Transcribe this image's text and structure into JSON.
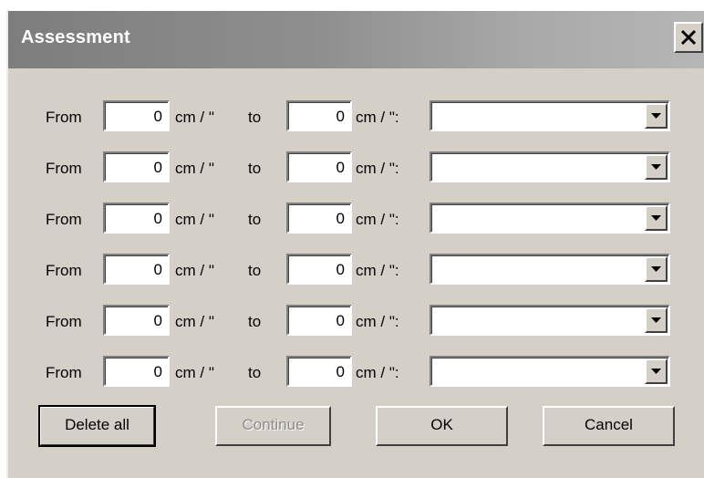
{
  "window": {
    "title": "Assessment"
  },
  "rows": [
    {
      "from_label": "From",
      "from_value": "0",
      "unit1": "cm / \"",
      "to_label": "to",
      "to_value": "0",
      "unit2": "cm / \":",
      "selected": ""
    },
    {
      "from_label": "From",
      "from_value": "0",
      "unit1": "cm / \"",
      "to_label": "to",
      "to_value": "0",
      "unit2": "cm / \":",
      "selected": ""
    },
    {
      "from_label": "From",
      "from_value": "0",
      "unit1": "cm / \"",
      "to_label": "to",
      "to_value": "0",
      "unit2": "cm / \":",
      "selected": ""
    },
    {
      "from_label": "From",
      "from_value": "0",
      "unit1": "cm / \"",
      "to_label": "to",
      "to_value": "0",
      "unit2": "cm / \":",
      "selected": ""
    },
    {
      "from_label": "From",
      "from_value": "0",
      "unit1": "cm / \"",
      "to_label": "to",
      "to_value": "0",
      "unit2": "cm / \":",
      "selected": ""
    },
    {
      "from_label": "From",
      "from_value": "0",
      "unit1": "cm / \"",
      "to_label": "to",
      "to_value": "0",
      "unit2": "cm / \":",
      "selected": ""
    }
  ],
  "buttons": {
    "delete_all": "Delete all",
    "continue": "Continue",
    "ok": "OK",
    "cancel": "Cancel"
  },
  "states": {
    "continue_enabled": false,
    "default_button": "delete_all"
  },
  "icons": {
    "close": "close-icon",
    "dropdown": "chevron-down-icon"
  }
}
